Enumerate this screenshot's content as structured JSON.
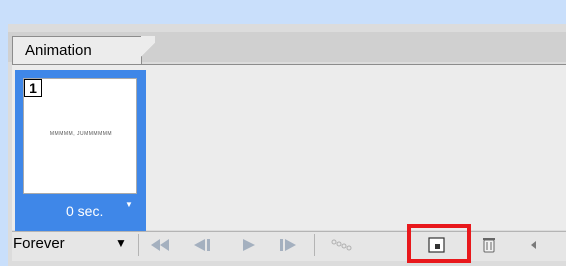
{
  "panel": {
    "tab_label": "Animation"
  },
  "frames": [
    {
      "number": "1",
      "delay": "0 sec.",
      "thumbnail_text": "MMMMM, JUMMMMMM"
    }
  ],
  "toolbar": {
    "loop_value": "Forever",
    "buttons": [
      "select-first-frame",
      "select-previous-frame",
      "play",
      "select-next-frame",
      "tween",
      "duplicate-frame",
      "delete-frame"
    ]
  },
  "icons": {
    "dropdown": "chevron-down",
    "scroll": "triangle-left"
  },
  "colors": {
    "selection": "#3f87e8",
    "highlight": "#e8181c"
  }
}
